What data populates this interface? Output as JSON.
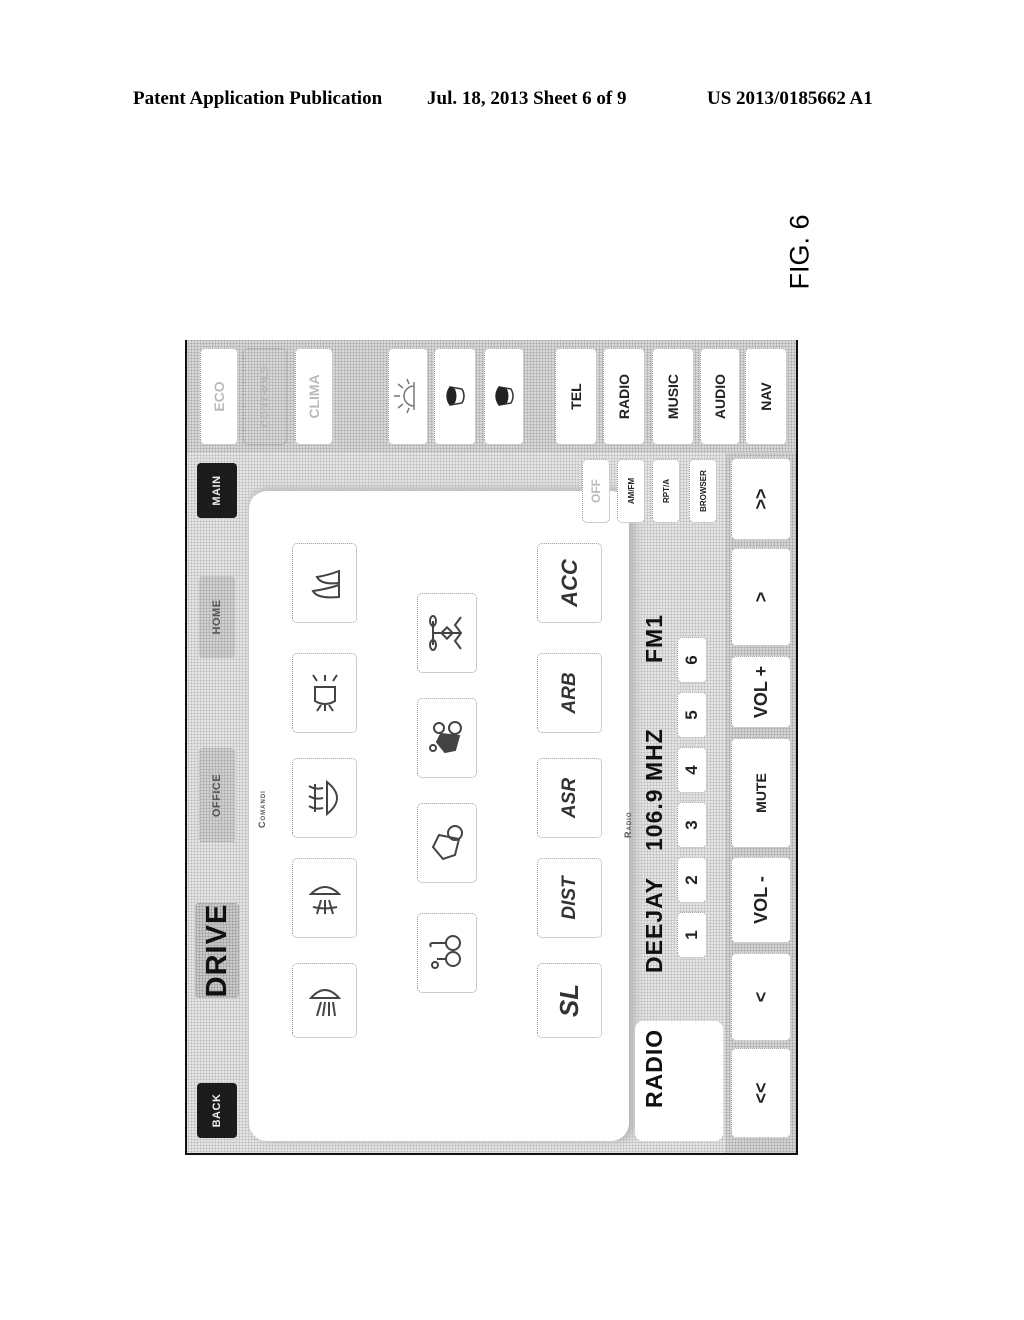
{
  "header": {
    "publication": "Patent Application Publication",
    "date_sheet": "Jul. 18, 2013   Sheet 6 of 9",
    "number": "US 2013/0185662 A1"
  },
  "figure_label": "FIG. 6",
  "ui": {
    "top_bar": {
      "back": "BACK",
      "title": "DRIVE",
      "office": "OFFICE",
      "home": "HOME",
      "main": "MAIN"
    },
    "content": {
      "section_label": "Comandi",
      "row1_icons": [
        {
          "icon": "low-beam-headlight-icon"
        },
        {
          "icon": "front-fog-light-icon"
        },
        {
          "icon": "rear-defrost-icon"
        },
        {
          "icon": "parking-lights-icon"
        },
        {
          "icon": "seat-adjust-icon"
        }
      ],
      "row2_icons": [
        {
          "icon": "driver-assist-icon"
        },
        {
          "icon": "hill-descent-icon"
        },
        {
          "icon": "traction-mode-icon"
        },
        {
          "icon": "drivetrain-icon"
        }
      ],
      "row3_buttons": [
        "SL",
        "DIST",
        "ASR",
        "ARB",
        "ACC"
      ]
    },
    "side_panel": {
      "buttons": [
        {
          "label": "ECO",
          "state": "disabled"
        },
        {
          "label": "CONTROLS",
          "state": "disabled"
        },
        {
          "label": "CLIMA",
          "state": "disabled"
        },
        {
          "label": "",
          "icon": "sun-brightness-icon"
        },
        {
          "label": "",
          "icon": "seat-heater-left-icon"
        },
        {
          "label": "",
          "icon": "seat-heater-right-icon"
        },
        {
          "label": "TEL"
        },
        {
          "label": "RADIO"
        },
        {
          "label": "MUSIC"
        },
        {
          "label": "AUDIO"
        },
        {
          "label": "NAV"
        }
      ]
    },
    "radio": {
      "label": "Radio",
      "source": "RADIO",
      "station": "DEEJAY",
      "frequency": "106.9 MHZ",
      "band": "FM1",
      "presets": [
        "1",
        "2",
        "3",
        "4",
        "5",
        "6"
      ],
      "options": [
        "OFF",
        "AM/FM",
        "RPT/A",
        "BROWSER"
      ]
    },
    "bottom_bar": {
      "buttons": [
        "<<",
        "<",
        "VOL -",
        "MUTE",
        "VOL +",
        ">",
        ">>"
      ]
    }
  }
}
